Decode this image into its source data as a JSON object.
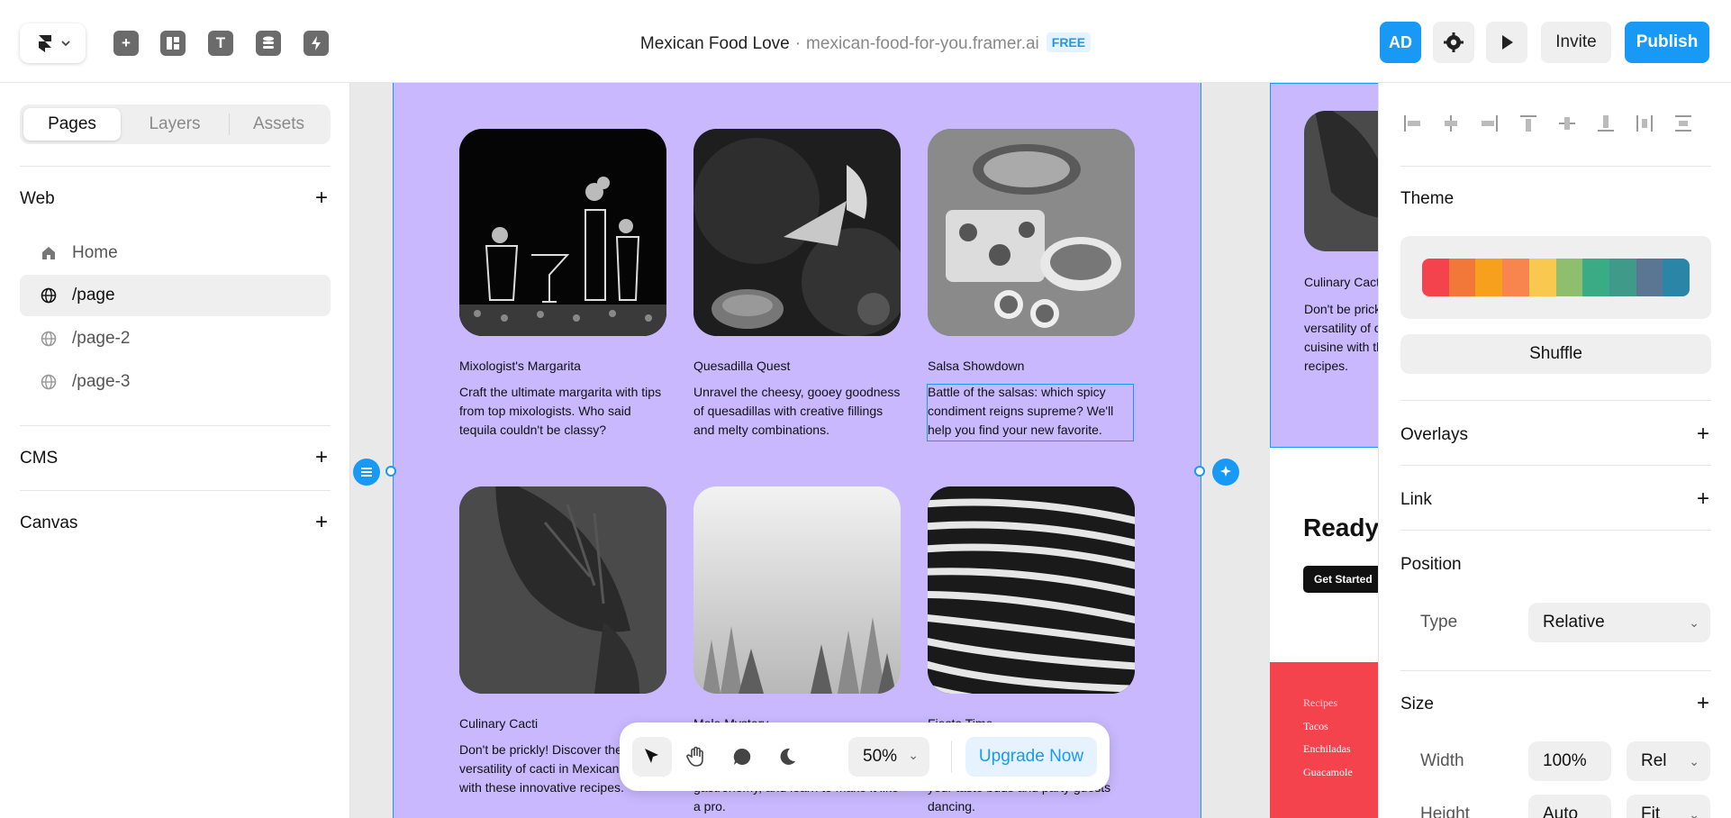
{
  "topbar": {
    "project_name": "Mexican Food Love",
    "separator": "·",
    "domain": "mexican-food-for-you.framer.ai",
    "plan_badge": "FREE",
    "avatar_initials": "AD",
    "invite_label": "Invite",
    "publish_label": "Publish",
    "tool_icons": [
      "insert-icon",
      "layout-icon",
      "text-icon",
      "cms-icon",
      "interactions-icon"
    ]
  },
  "left_panel": {
    "tabs": [
      "Pages",
      "Layers",
      "Assets"
    ],
    "web_section": "Web",
    "pages": [
      {
        "label": "Home",
        "icon": "home-icon"
      },
      {
        "label": "/page",
        "icon": "globe-icon",
        "active": true
      },
      {
        "label": "/page-2",
        "icon": "globe-icon"
      },
      {
        "label": "/page-3",
        "icon": "globe-icon"
      }
    ],
    "cms_section": "CMS",
    "canvas_section": "Canvas"
  },
  "canvas": {
    "frame_color": "#c9b8fe",
    "cards": [
      {
        "title": "Mixologist's Margarita",
        "desc": "Craft the ultimate margarita with tips from top mixologists. Who said tequila couldn't be classy?"
      },
      {
        "title": "Quesadilla Quest",
        "desc": "Unravel the cheesy, gooey goodness of quesadillas with creative fillings and melty combinations."
      },
      {
        "title": "Salsa Showdown",
        "desc": "Battle of the salsas: which spicy condiment reigns supreme? We'll help you find your new favorite."
      },
      {
        "title": "Culinary Cacti",
        "desc": "Don't be prickly! Discover the versatility of cacti in Mexican cuisine with these innovative recipes."
      },
      {
        "title": "Mole Mystery",
        "desc": "gastronomy, and learn to make it like a pro."
      },
      {
        "title": "Fiesta Time",
        "desc": "your taste buds and party guests dancing."
      }
    ],
    "preview": {
      "title": "Culinary Cacti",
      "desc": "Don't be prickly! Discover the versatility of cacti in Mexican cuisine with these innovative recipes.",
      "cta_heading": "Ready",
      "cta_button": "Get Started",
      "footer_links": [
        "Recipes",
        "Tacos",
        "Enchiladas",
        "Guacamole"
      ]
    }
  },
  "floating_toolbar": {
    "zoom": "50%",
    "upgrade_label": "Upgrade Now"
  },
  "right_panel": {
    "theme_label": "Theme",
    "theme_swatches": [
      "#f5434e",
      "#f2783a",
      "#f7a01e",
      "#f8844e",
      "#f9c84e",
      "#8fbf6e",
      "#3aab85",
      "#3f9a8a",
      "#5a7692",
      "#2a85a6"
    ],
    "shuffle_label": "Shuffle",
    "overlays_label": "Overlays",
    "link_label": "Link",
    "position_label": "Position",
    "type_label": "Type",
    "type_value": "Relative",
    "size_label": "Size",
    "width_label": "Width",
    "width_value": "100%",
    "width_unit": "Rel",
    "height_label": "Height",
    "height_value": "Auto",
    "height_unit": "Fit"
  }
}
